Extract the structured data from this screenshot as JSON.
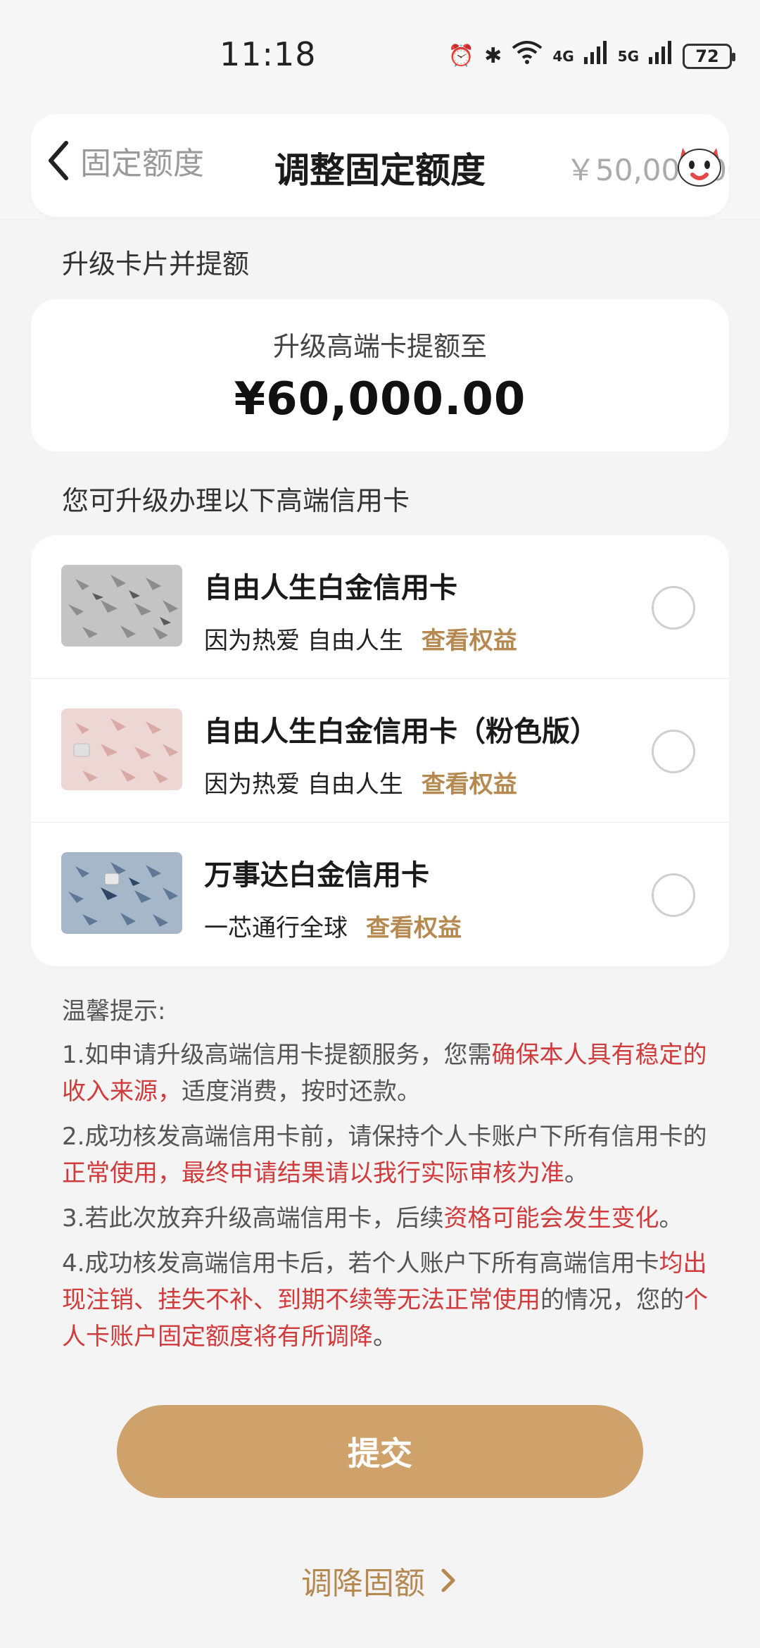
{
  "status_bar": {
    "time": "11:18",
    "signal_1": "4G",
    "signal_2": "5G",
    "battery": "72"
  },
  "header": {
    "back_label": "固定额度",
    "title": "调整固定额度",
    "amount": "￥50,000.00"
  },
  "upgrade_section": {
    "title": "升级卡片并提额",
    "subtitle": "升级高端卡提额至",
    "amount": "¥60,000.00"
  },
  "cards_section": {
    "title": "您可升级办理以下高端信用卡",
    "cards": [
      {
        "name": "自由人生白金信用卡",
        "desc": "因为热爱 自由人生",
        "benefit": "查看权益",
        "color": "#b9b9b9"
      },
      {
        "name": "自由人生白金信用卡（粉色版）",
        "desc": "因为热爱 自由人生",
        "benefit": "查看权益",
        "color": "#e8c9c6"
      },
      {
        "name": "万事达白金信用卡",
        "desc": "一芯通行全球",
        "benefit": "查看权益",
        "color": "#8fa7c1"
      }
    ]
  },
  "tips": {
    "title": "温馨提示:",
    "items": [
      [
        {
          "t": "1.如申请升级高端信用卡提额服务，您需"
        },
        {
          "t": "确保本人具有稳定的收入来源，",
          "red": true
        },
        {
          "t": "适度消费，按时还款。"
        }
      ],
      [
        {
          "t": "2.成功核发高端信用卡前，请保持个人卡账户下所有信用卡的"
        },
        {
          "t": "正常使用，最终申请结果请以我行实际审核为准",
          "red": true
        },
        {
          "t": "。"
        }
      ],
      [
        {
          "t": "3.若此次放弃升级高端信用卡，后续"
        },
        {
          "t": "资格可能会发生变化",
          "red": true
        },
        {
          "t": "。"
        }
      ],
      [
        {
          "t": "4.成功核发高端信用卡后，若个人账户下所有高端信用卡"
        },
        {
          "t": "均出现注销、挂失不补、到期不续等无法正常使用",
          "red": true
        },
        {
          "t": "的情况，您的"
        },
        {
          "t": "个人卡账户固定额度将有所调降",
          "red": true
        },
        {
          "t": "。"
        }
      ]
    ]
  },
  "buttons": {
    "submit": "提交",
    "reduce": "调降固额"
  },
  "colors": {
    "accent": "#cfa26c",
    "benefit": "#b58950",
    "warning": "#d23b3b"
  },
  "icons": {
    "back": "chevron-left-icon",
    "mascot": "cat-mascot-icon",
    "chevron": "chevron-right-icon"
  }
}
